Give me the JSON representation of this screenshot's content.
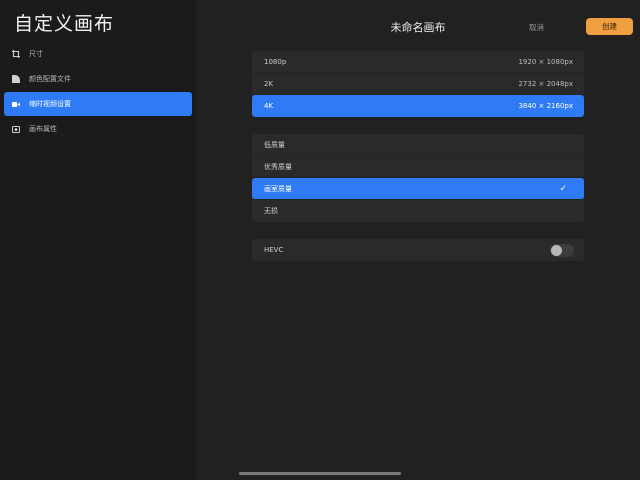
{
  "page": {
    "title": "自定义画布"
  },
  "sidebar": {
    "items": [
      {
        "label": "尺寸",
        "icon": "crop-icon",
        "active": false
      },
      {
        "label": "颜色配置文件",
        "icon": "color-profile-icon",
        "active": false
      },
      {
        "label": "缩时视频设置",
        "icon": "video-camera-icon",
        "active": true
      },
      {
        "label": "画布属性",
        "icon": "canvas-properties-icon",
        "active": false
      }
    ]
  },
  "header": {
    "canvas_name": "未命名画布",
    "cancel_label": "取消",
    "create_label": "创建"
  },
  "resolution": {
    "options": [
      {
        "label": "1080p",
        "size": "1920 × 1080px",
        "selected": false
      },
      {
        "label": "2K",
        "size": "2732 × 2048px",
        "selected": false
      },
      {
        "label": "4K",
        "size": "3840 × 2160px",
        "selected": true
      }
    ]
  },
  "quality": {
    "options": [
      {
        "label": "低质量",
        "selected": false
      },
      {
        "label": "优秀质量",
        "selected": false
      },
      {
        "label": "画室质量",
        "selected": true
      },
      {
        "label": "无损",
        "selected": false
      }
    ]
  },
  "hevc": {
    "label": "HEVC",
    "enabled": false
  },
  "colors": {
    "accent": "#2f7bf5",
    "create_button": "#f0a040",
    "background": "#1b1b1b"
  }
}
